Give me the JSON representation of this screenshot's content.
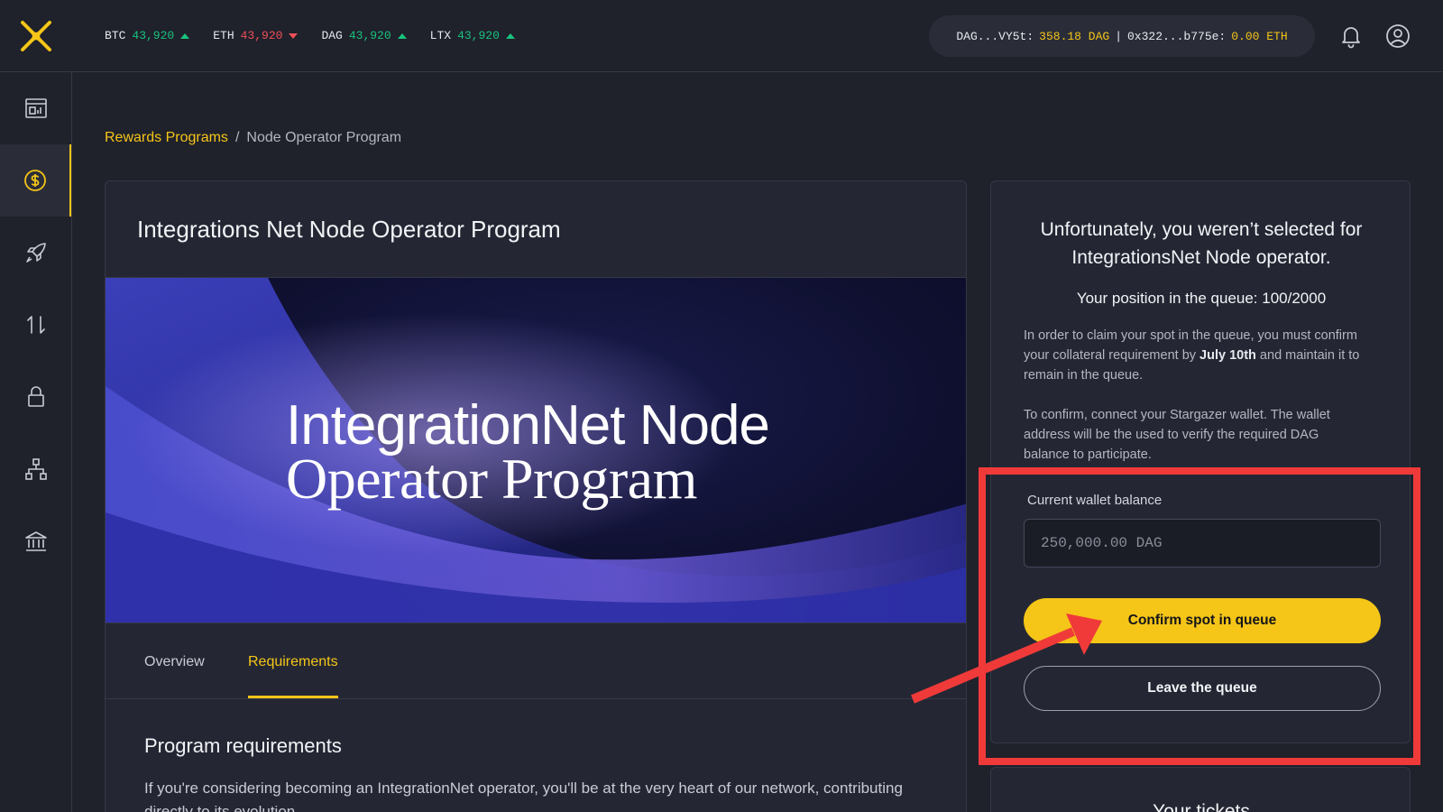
{
  "topbar": {
    "tickers": [
      {
        "symbol": "BTC",
        "value": "43,920",
        "direction": "up"
      },
      {
        "symbol": "ETH",
        "value": "43,920",
        "direction": "down"
      },
      {
        "symbol": "DAG",
        "value": "43,920",
        "direction": "up"
      },
      {
        "symbol": "LTX",
        "value": "43,920",
        "direction": "up"
      }
    ],
    "wallet": {
      "dag_address": "DAG...VY5t:",
      "dag_balance": "358.18 DAG",
      "separator": "|",
      "eth_address": "0x322...b775e:",
      "eth_balance": "0.00 ETH"
    }
  },
  "sidebar": {
    "items": [
      {
        "icon": "dashboard-icon",
        "active": false
      },
      {
        "icon": "rewards-coin-icon",
        "active": true
      },
      {
        "icon": "rocket-icon",
        "active": false
      },
      {
        "icon": "swap-icon",
        "active": false
      },
      {
        "icon": "lock-icon",
        "active": false
      },
      {
        "icon": "network-nodes-icon",
        "active": false
      },
      {
        "icon": "bank-icon",
        "active": false
      }
    ]
  },
  "breadcrumb": {
    "parent": "Rewards Programs",
    "separator": "/",
    "current": "Node Operator Program"
  },
  "main": {
    "title": "Integrations Net Node Operator Program",
    "banner": {
      "line1": "IntegrationNet Node",
      "line2": "Operator Program"
    },
    "tabs": [
      "Overview",
      "Requirements"
    ],
    "active_tab": "Requirements",
    "requirements_title": "Program requirements",
    "requirements_body": "If you're considering becoming an IntegrationNet operator, you'll be at the very heart of our network, contributing directly to its evolution."
  },
  "status_card": {
    "heading": "Unfortunately, you weren’t selected for IntegrationsNet Node operator.",
    "queue_position": "Your position in the queue: 100/2000",
    "para1_before": "In order to claim your spot in the queue, you must confirm your collateral requirement by ",
    "para1_date": "July 10th",
    "para1_after": " and maintain it to remain in the queue.",
    "para2": "To confirm, connect your Stargazer wallet. The wallet address will be the used to verify the required DAG balance to participate.",
    "balance_label": "Current wallet balance",
    "balance_value": "250,000.00 DAG",
    "confirm_label": "Confirm spot in queue",
    "leave_label": "Leave the queue"
  },
  "tickets_card": {
    "title": "Your tickets"
  },
  "colors": {
    "accent": "#f5c518",
    "background": "#1f212b",
    "card": "#242733",
    "up": "#19c37d",
    "down": "#f0505a",
    "annotation": "#f03a3a"
  }
}
